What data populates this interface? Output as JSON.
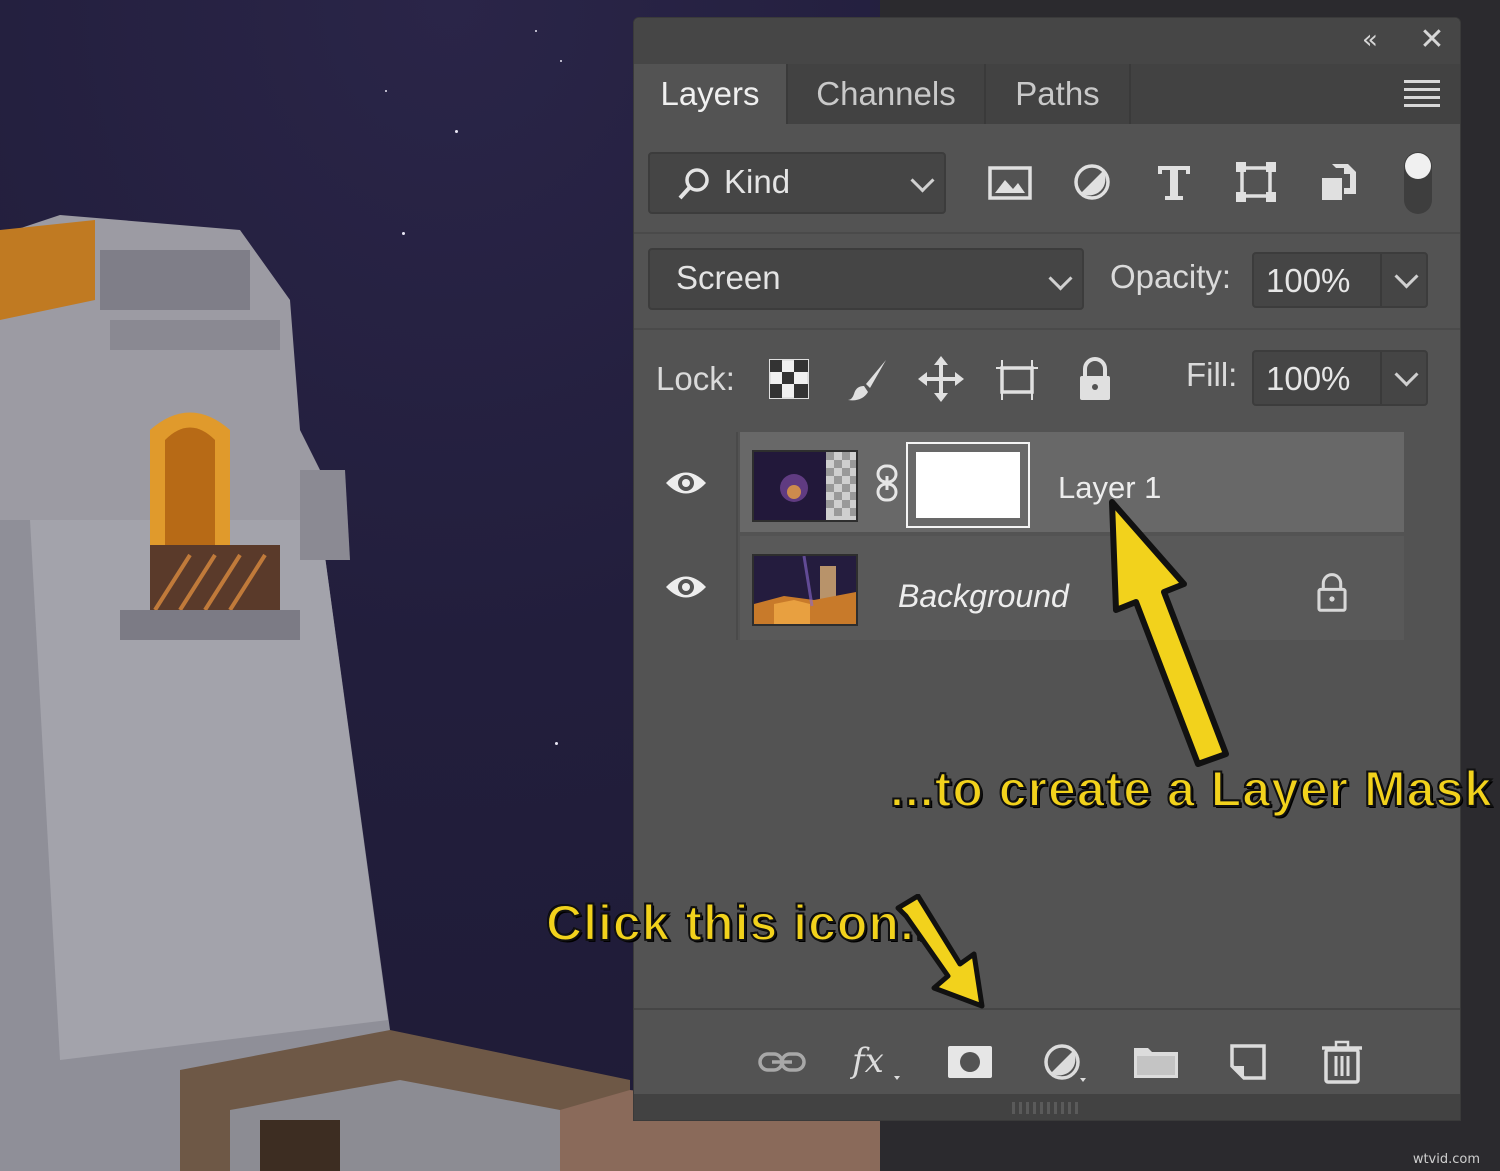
{
  "panel": {
    "collapse_glyph": "«",
    "close_glyph": "✕",
    "tabs": [
      {
        "label": "Layers",
        "active": true
      },
      {
        "label": "Channels",
        "active": false
      },
      {
        "label": "Paths",
        "active": false
      }
    ],
    "filter": {
      "kind_label": "Kind",
      "icons": [
        "pixel-layer-filter-icon",
        "adjustment-layer-filter-icon",
        "type-layer-filter-icon",
        "shape-layer-filter-icon",
        "smart-object-filter-icon"
      ]
    },
    "blend_mode": "Screen",
    "opacity_label": "Opacity:",
    "opacity_value": "100%",
    "lock_label": "Lock:",
    "lock_icons": [
      "lock-transparent-pixels-icon",
      "lock-image-pixels-icon",
      "lock-position-icon",
      "lock-artboard-icon",
      "lock-all-icon"
    ],
    "fill_label": "Fill:",
    "fill_value": "100%",
    "layers": [
      {
        "name": "Layer 1",
        "selected": true,
        "visible": true,
        "has_mask": true,
        "locked": false
      },
      {
        "name": "Background",
        "selected": false,
        "visible": true,
        "has_mask": false,
        "locked": true
      }
    ],
    "bottom_icons": [
      "link-layers-icon",
      "fx-icon",
      "add-layer-mask-icon",
      "adjustment-layer-icon",
      "group-folder-icon",
      "new-layer-icon",
      "delete-layer-icon"
    ]
  },
  "annotations": {
    "mask_note": "...to create a Layer Mask",
    "click_note": "Click this icon..."
  },
  "watermark": "wtvid.com",
  "colors": {
    "panel_bg": "#535353",
    "selected_layer": "#686868",
    "annotation_yellow": "#f2d21c"
  }
}
